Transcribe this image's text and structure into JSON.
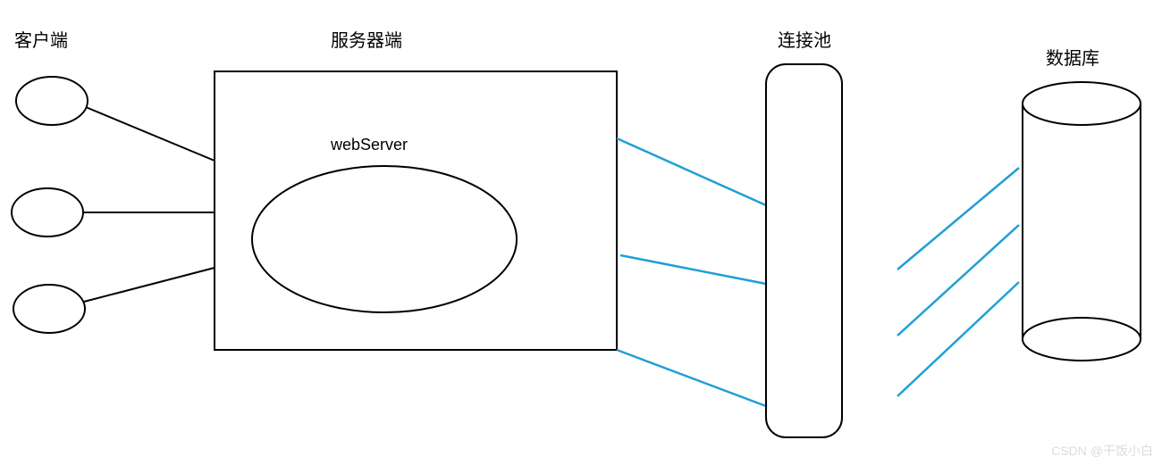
{
  "labels": {
    "client": "客户端",
    "server": "服务器端",
    "webserver": "webServer",
    "pool": "连接池",
    "database": "数据库",
    "watermark": "CSDN @干饭小白"
  },
  "colors": {
    "line_black": "#000000",
    "line_blue": "#1f9fd6",
    "watermark": "#dcdcdc"
  }
}
